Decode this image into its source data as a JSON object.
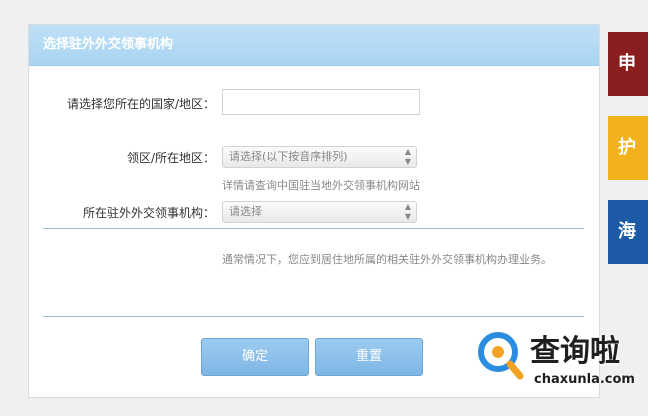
{
  "panel": {
    "title": "选择驻外外交领事机构"
  },
  "form": {
    "country_label": "请选择您所在的国家/地区：",
    "country_value": "",
    "consular_area_label": "领区/所在地区：",
    "consular_area_select": "请选择(以下按音序排列)",
    "consular_area_hint": "详情请查询中国驻当地外交领事机构网站",
    "mission_label": "所在驻外外交领事机构：",
    "mission_select": "请选择",
    "note": "通常情况下，您应到居住地所属的相关驻外外交领事机构办理业务。"
  },
  "buttons": {
    "confirm": "确定",
    "reset": "重置"
  },
  "side_tabs": [
    {
      "label": "申",
      "color": "#8a1d1d"
    },
    {
      "label": "护",
      "color": "#f1b21b"
    },
    {
      "label": "海",
      "color": "#1c5aa6"
    }
  ],
  "watermark": {
    "name": "查询啦",
    "domain": "chaxunla.com"
  }
}
